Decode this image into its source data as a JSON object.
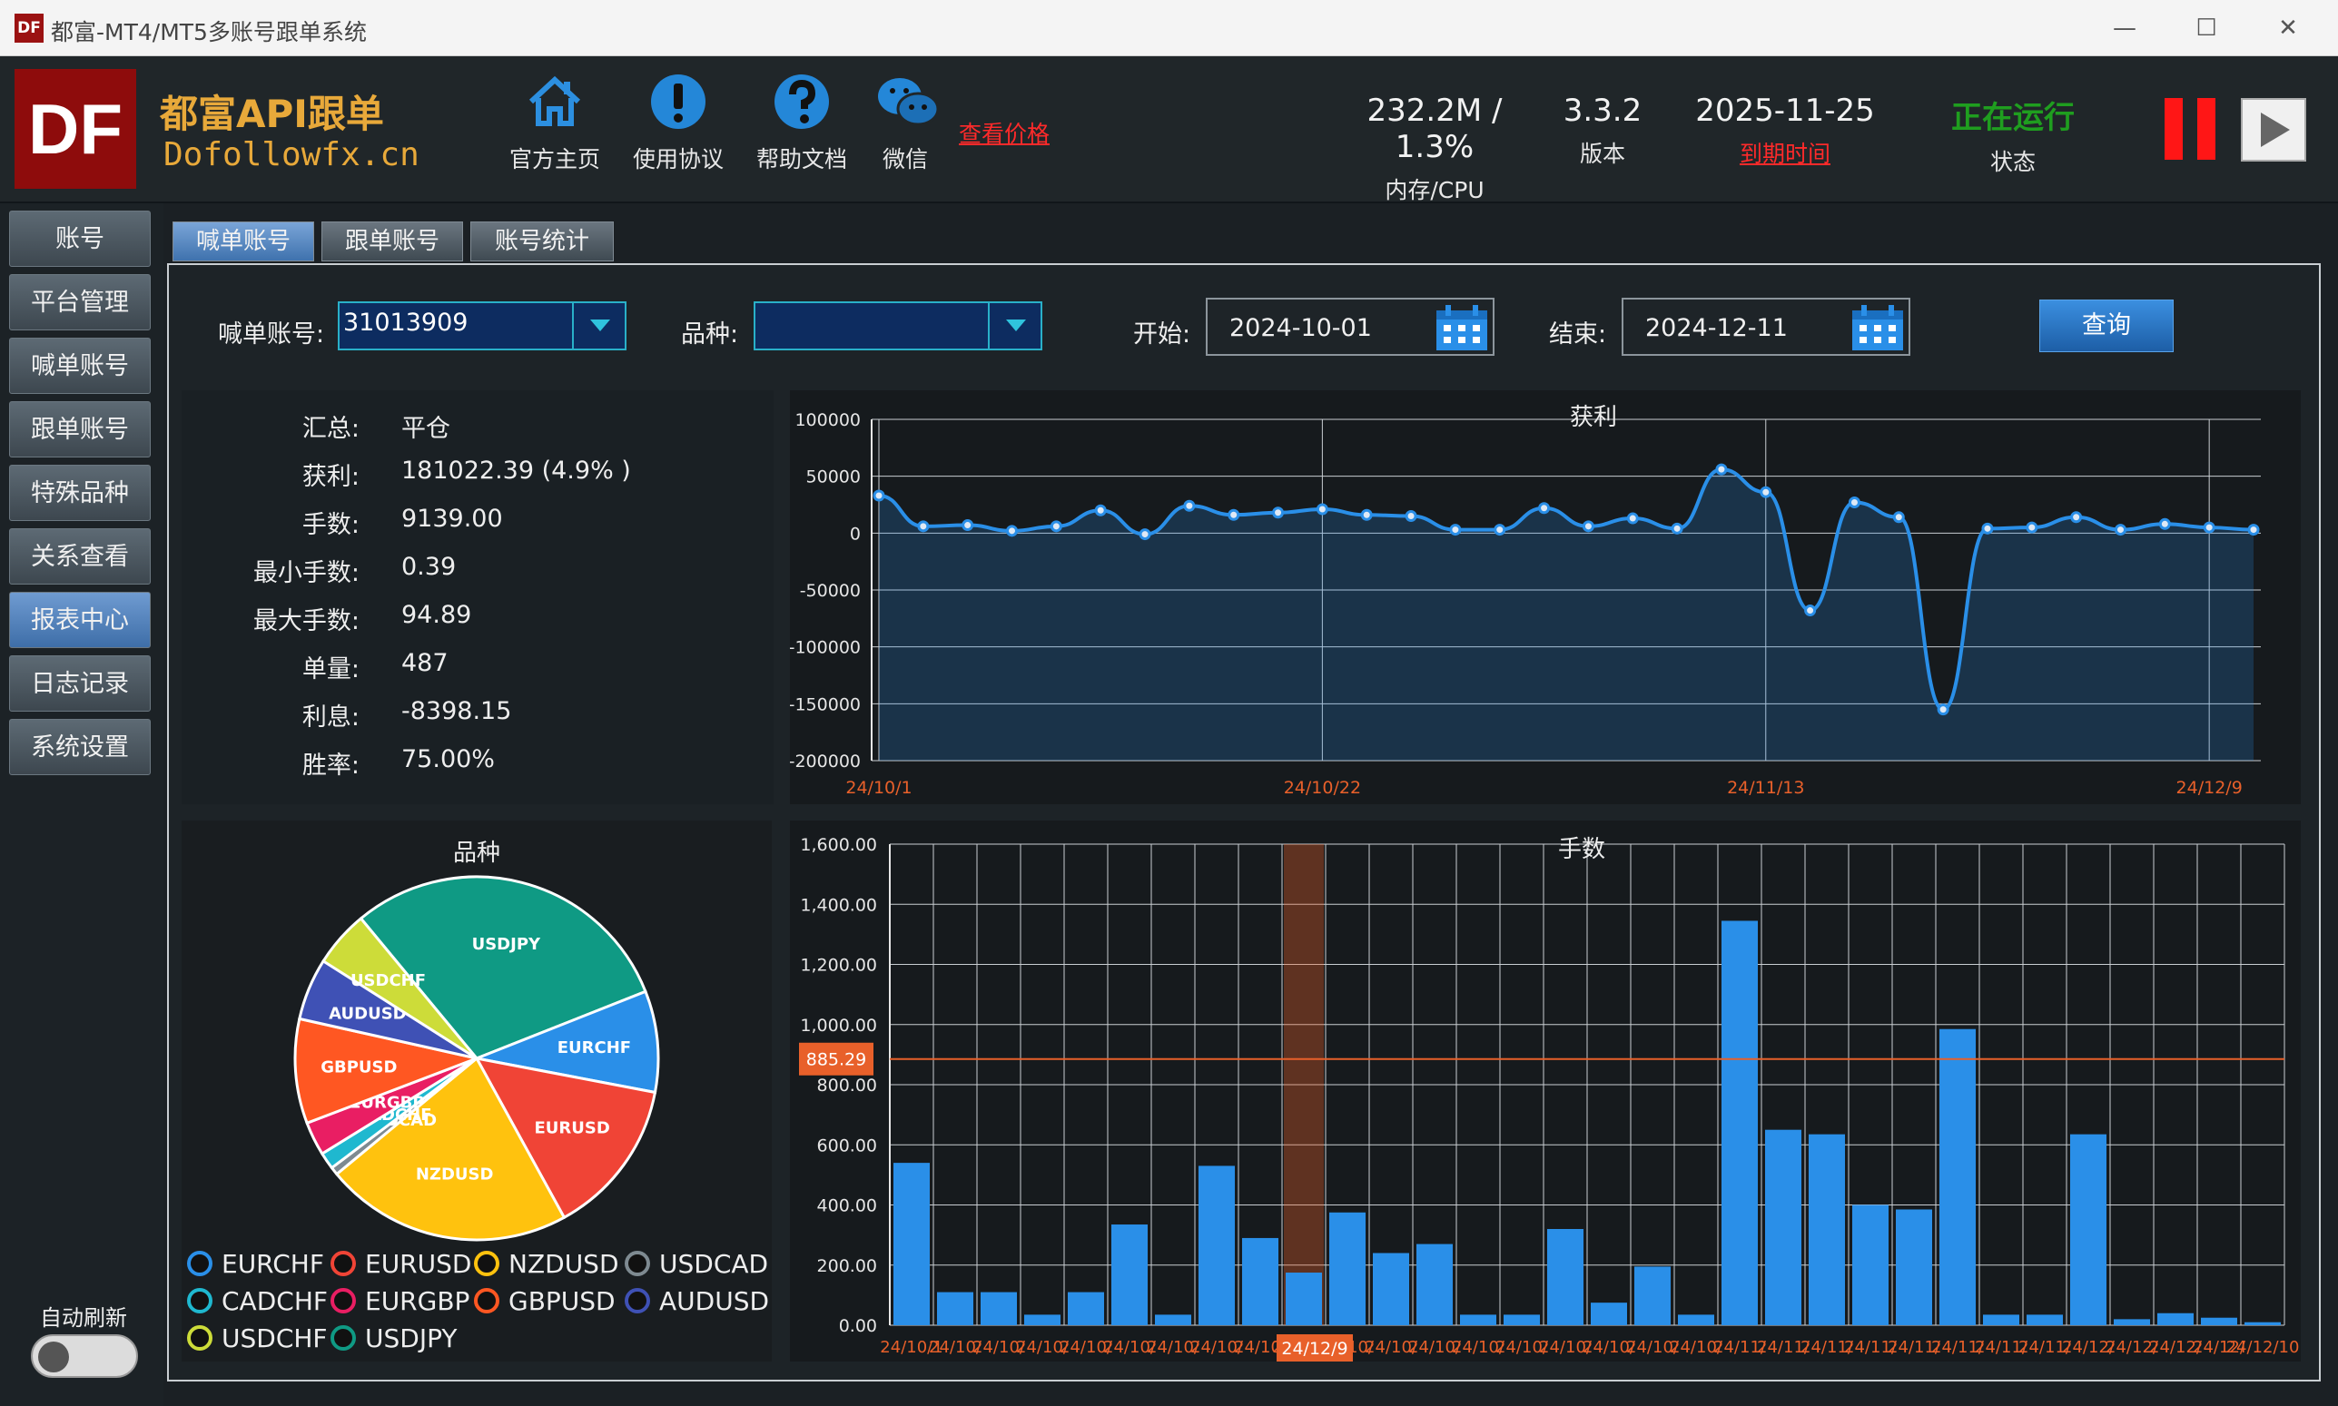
{
  "window": {
    "title": "都富-MT4/MT5多账号跟单系统",
    "minimize": "—",
    "maximize": "☐",
    "close": "✕"
  },
  "header": {
    "logo_text": "DF",
    "brand_name": "都富API跟单",
    "brand_url": "Dofollowfx.cn",
    "nav": [
      {
        "label": "官方主页",
        "icon": "home-icon"
      },
      {
        "label": "使用协议",
        "icon": "exclamation-icon"
      },
      {
        "label": "帮助文档",
        "icon": "question-icon"
      },
      {
        "label": "微信",
        "icon": "wechat-icon"
      }
    ],
    "price_link": "查看价格",
    "memory_cpu": {
      "value": "232.2M / 1.3%",
      "label": "内存/CPU"
    },
    "version": {
      "value": "3.3.2",
      "label": "版本"
    },
    "expiry": {
      "value": "2025-11-25",
      "label": "到期时间"
    },
    "status": {
      "value": "正在运行",
      "label": "状态"
    },
    "colors": {
      "running": "#1f9e1f",
      "expiry_link": "#ff2a2a",
      "pause": "#ff1616"
    }
  },
  "sidebar": {
    "items": [
      "账号",
      "平台管理",
      "喊单账号",
      "跟单账号",
      "特殊品种",
      "关系查看",
      "报表中心",
      "日志记录",
      "系统设置"
    ],
    "active": "报表中心",
    "auto_refresh": "自动刷新"
  },
  "tabs": {
    "items": [
      "喊单账号",
      "跟单账号",
      "账号统计"
    ],
    "active": "喊单账号"
  },
  "filters": {
    "account_label": "喊单账号:",
    "account_value": "31013909",
    "symbol_label": "品种:",
    "symbol_value": "",
    "start_label": "开始:",
    "start_value": "2024-10-01",
    "end_label": "结束:",
    "end_value": "2024-12-11",
    "query_button": "查询"
  },
  "summary": [
    {
      "key": "汇总:",
      "value": "平仓"
    },
    {
      "key": "获利:",
      "value": "181022.39 (4.9% )"
    },
    {
      "key": "手数:",
      "value": "9139.00"
    },
    {
      "key": "最小手数:",
      "value": "0.39"
    },
    {
      "key": "最大手数:",
      "value": "94.89"
    },
    {
      "key": "单量:",
      "value": "487"
    },
    {
      "key": "利息:",
      "value": "-8398.15"
    },
    {
      "key": "胜率:",
      "value": "75.00%"
    }
  ],
  "chart_data": [
    {
      "type": "area",
      "title": "获利",
      "ylim": [
        -200000,
        100000
      ],
      "y_ticks": [
        "100000",
        "50000",
        "0",
        "-50000",
        "-100000",
        "-150000",
        "-200000"
      ],
      "x_tick_labels": [
        "24/10/1",
        "24/10/22",
        "24/11/13",
        "24/12/9"
      ],
      "x_tick_index": [
        0,
        10,
        20,
        30
      ],
      "values": [
        33000,
        6000,
        7000,
        2000,
        6000,
        20000,
        -1000,
        24000,
        16000,
        18000,
        21000,
        16000,
        15000,
        3000,
        3000,
        22000,
        6000,
        13000,
        4000,
        56000,
        36000,
        -68000,
        27000,
        14000,
        -155000,
        4000,
        5000,
        14000,
        3000,
        8000,
        5000,
        3000
      ],
      "color": "#2a8fe8",
      "grid": true
    },
    {
      "type": "bar",
      "title": "手数",
      "ylim": [
        0,
        1600
      ],
      "y_ticks": [
        "1,600.00",
        "1,400.00",
        "1,200.00",
        "1,000.00",
        "800.00",
        "600.00",
        "400.00",
        "200.00",
        "0.00"
      ],
      "categories": [
        "24/10/1",
        "24/10/",
        "24/10/",
        "24/10/",
        "24/10/",
        "24/10/",
        "24/10/",
        "24/10/",
        "24/10/",
        "24/12/9",
        "24/10/",
        "24/10/",
        "24/10/",
        "24/10/",
        "24/10/",
        "24/10/",
        "24/10/",
        "24/10/",
        "24/10/",
        "24/11/",
        "24/11/",
        "24/11/",
        "24/11/",
        "24/11/",
        "24/11/",
        "24/11/",
        "24/11/",
        "24/12/",
        "24/12/",
        "24/12/",
        "24/12/",
        "24/12/10"
      ],
      "values": [
        540,
        110,
        110,
        35,
        110,
        335,
        35,
        530,
        290,
        175,
        375,
        240,
        270,
        35,
        35,
        320,
        75,
        195,
        35,
        1345,
        650,
        635,
        400,
        385,
        985,
        35,
        35,
        635,
        20,
        40,
        25,
        10
      ],
      "highlight_index": 9,
      "highlight_label": "24/12/9",
      "reference_line": {
        "value": 885.29,
        "label": "885.29"
      },
      "color": "#2a8fe8",
      "highlight_color": "#e8602a",
      "grid": true
    },
    {
      "type": "pie",
      "title": "品种",
      "slices": [
        {
          "label": "USDJPY",
          "value": 30.0,
          "color": "#0f9a84"
        },
        {
          "label": "EURCHF",
          "value": 9.0,
          "color": "#2a8fe8"
        },
        {
          "label": "EURUSD",
          "value": 14.0,
          "color": "#f04436"
        },
        {
          "label": "NZDUSD",
          "value": 22.0,
          "color": "#ffc20e"
        },
        {
          "label": "USDCAD",
          "value": 0.7,
          "color": "#7e8a91"
        },
        {
          "label": "CADCHF",
          "value": 1.5,
          "color": "#1fb8cf"
        },
        {
          "label": "EURGBP",
          "value": 3.0,
          "color": "#e91e63"
        },
        {
          "label": "GBPUSD",
          "value": 9.3,
          "color": "#ff5722"
        },
        {
          "label": "AUDUSD",
          "value": 5.5,
          "color": "#3f51b5"
        },
        {
          "label": "USDCHF",
          "value": 5.0,
          "color": "#cddc39"
        }
      ],
      "legend": [
        "EURCHF",
        "EURUSD",
        "NZDUSD",
        "USDCAD",
        "CADCHF",
        "EURGBP",
        "GBPUSD",
        "AUDUSD",
        "USDCHF",
        "USDJPY"
      ]
    }
  ]
}
